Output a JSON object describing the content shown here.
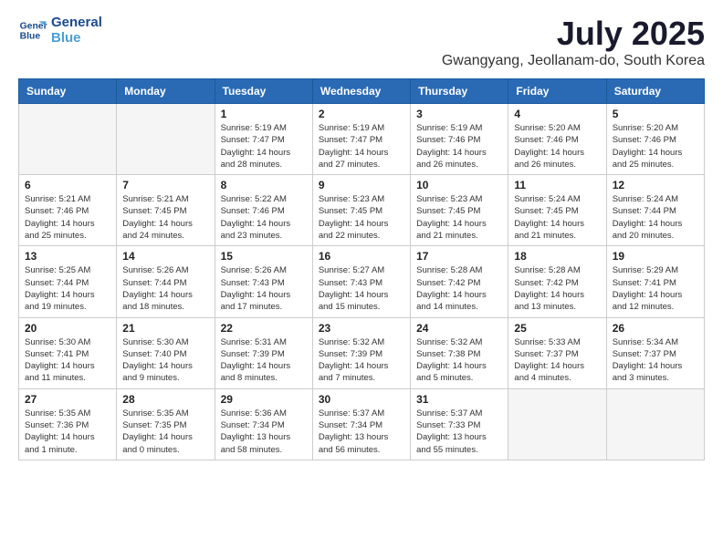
{
  "logo": {
    "line1": "General",
    "line2": "Blue"
  },
  "title": "July 2025",
  "location": "Gwangyang, Jeollanam-do, South Korea",
  "days_of_week": [
    "Sunday",
    "Monday",
    "Tuesday",
    "Wednesday",
    "Thursday",
    "Friday",
    "Saturday"
  ],
  "weeks": [
    [
      {
        "day": "",
        "info": ""
      },
      {
        "day": "",
        "info": ""
      },
      {
        "day": "1",
        "info": "Sunrise: 5:19 AM\nSunset: 7:47 PM\nDaylight: 14 hours and 28 minutes."
      },
      {
        "day": "2",
        "info": "Sunrise: 5:19 AM\nSunset: 7:47 PM\nDaylight: 14 hours and 27 minutes."
      },
      {
        "day": "3",
        "info": "Sunrise: 5:19 AM\nSunset: 7:46 PM\nDaylight: 14 hours and 26 minutes."
      },
      {
        "day": "4",
        "info": "Sunrise: 5:20 AM\nSunset: 7:46 PM\nDaylight: 14 hours and 26 minutes."
      },
      {
        "day": "5",
        "info": "Sunrise: 5:20 AM\nSunset: 7:46 PM\nDaylight: 14 hours and 25 minutes."
      }
    ],
    [
      {
        "day": "6",
        "info": "Sunrise: 5:21 AM\nSunset: 7:46 PM\nDaylight: 14 hours and 25 minutes."
      },
      {
        "day": "7",
        "info": "Sunrise: 5:21 AM\nSunset: 7:45 PM\nDaylight: 14 hours and 24 minutes."
      },
      {
        "day": "8",
        "info": "Sunrise: 5:22 AM\nSunset: 7:46 PM\nDaylight: 14 hours and 23 minutes."
      },
      {
        "day": "9",
        "info": "Sunrise: 5:23 AM\nSunset: 7:45 PM\nDaylight: 14 hours and 22 minutes."
      },
      {
        "day": "10",
        "info": "Sunrise: 5:23 AM\nSunset: 7:45 PM\nDaylight: 14 hours and 21 minutes."
      },
      {
        "day": "11",
        "info": "Sunrise: 5:24 AM\nSunset: 7:45 PM\nDaylight: 14 hours and 21 minutes."
      },
      {
        "day": "12",
        "info": "Sunrise: 5:24 AM\nSunset: 7:44 PM\nDaylight: 14 hours and 20 minutes."
      }
    ],
    [
      {
        "day": "13",
        "info": "Sunrise: 5:25 AM\nSunset: 7:44 PM\nDaylight: 14 hours and 19 minutes."
      },
      {
        "day": "14",
        "info": "Sunrise: 5:26 AM\nSunset: 7:44 PM\nDaylight: 14 hours and 18 minutes."
      },
      {
        "day": "15",
        "info": "Sunrise: 5:26 AM\nSunset: 7:43 PM\nDaylight: 14 hours and 17 minutes."
      },
      {
        "day": "16",
        "info": "Sunrise: 5:27 AM\nSunset: 7:43 PM\nDaylight: 14 hours and 15 minutes."
      },
      {
        "day": "17",
        "info": "Sunrise: 5:28 AM\nSunset: 7:42 PM\nDaylight: 14 hours and 14 minutes."
      },
      {
        "day": "18",
        "info": "Sunrise: 5:28 AM\nSunset: 7:42 PM\nDaylight: 14 hours and 13 minutes."
      },
      {
        "day": "19",
        "info": "Sunrise: 5:29 AM\nSunset: 7:41 PM\nDaylight: 14 hours and 12 minutes."
      }
    ],
    [
      {
        "day": "20",
        "info": "Sunrise: 5:30 AM\nSunset: 7:41 PM\nDaylight: 14 hours and 11 minutes."
      },
      {
        "day": "21",
        "info": "Sunrise: 5:30 AM\nSunset: 7:40 PM\nDaylight: 14 hours and 9 minutes."
      },
      {
        "day": "22",
        "info": "Sunrise: 5:31 AM\nSunset: 7:39 PM\nDaylight: 14 hours and 8 minutes."
      },
      {
        "day": "23",
        "info": "Sunrise: 5:32 AM\nSunset: 7:39 PM\nDaylight: 14 hours and 7 minutes."
      },
      {
        "day": "24",
        "info": "Sunrise: 5:32 AM\nSunset: 7:38 PM\nDaylight: 14 hours and 5 minutes."
      },
      {
        "day": "25",
        "info": "Sunrise: 5:33 AM\nSunset: 7:37 PM\nDaylight: 14 hours and 4 minutes."
      },
      {
        "day": "26",
        "info": "Sunrise: 5:34 AM\nSunset: 7:37 PM\nDaylight: 14 hours and 3 minutes."
      }
    ],
    [
      {
        "day": "27",
        "info": "Sunrise: 5:35 AM\nSunset: 7:36 PM\nDaylight: 14 hours and 1 minute."
      },
      {
        "day": "28",
        "info": "Sunrise: 5:35 AM\nSunset: 7:35 PM\nDaylight: 14 hours and 0 minutes."
      },
      {
        "day": "29",
        "info": "Sunrise: 5:36 AM\nSunset: 7:34 PM\nDaylight: 13 hours and 58 minutes."
      },
      {
        "day": "30",
        "info": "Sunrise: 5:37 AM\nSunset: 7:34 PM\nDaylight: 13 hours and 56 minutes."
      },
      {
        "day": "31",
        "info": "Sunrise: 5:37 AM\nSunset: 7:33 PM\nDaylight: 13 hours and 55 minutes."
      },
      {
        "day": "",
        "info": ""
      },
      {
        "day": "",
        "info": ""
      }
    ]
  ]
}
